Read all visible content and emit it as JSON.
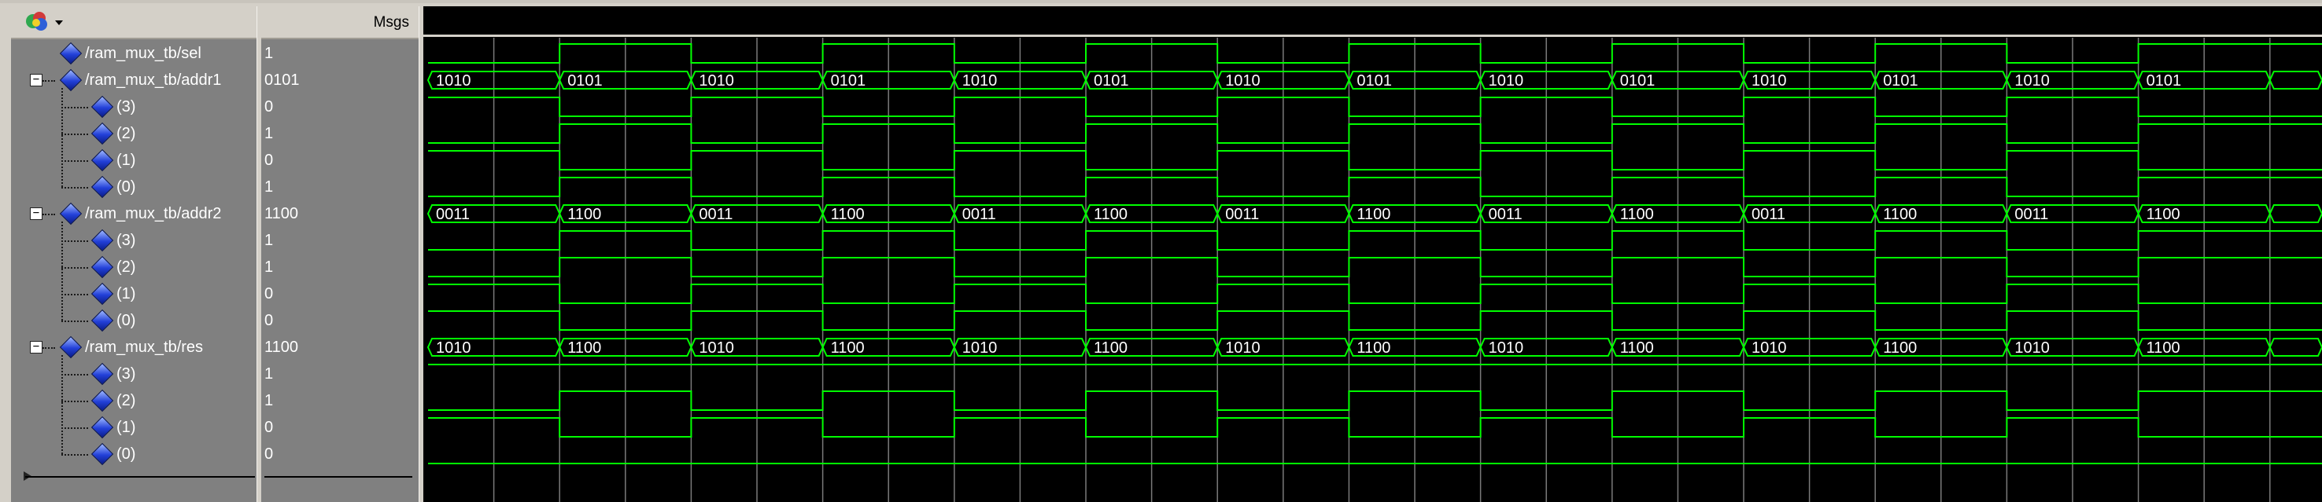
{
  "toolbar": {
    "wave_icon": "wave-palette-icon",
    "msgs_label": "Msgs"
  },
  "signals": [
    {
      "name": "/ram_mux_tb/sel",
      "value": "1",
      "kind": "bit",
      "level": 0
    },
    {
      "name": "/ram_mux_tb/addr1",
      "value": "0101",
      "kind": "bus",
      "level": 0,
      "expanded": true
    },
    {
      "name": "(3)",
      "value": "0",
      "kind": "bit",
      "level": 1
    },
    {
      "name": "(2)",
      "value": "1",
      "kind": "bit",
      "level": 1
    },
    {
      "name": "(1)",
      "value": "0",
      "kind": "bit",
      "level": 1
    },
    {
      "name": "(0)",
      "value": "1",
      "kind": "bit",
      "level": 1
    },
    {
      "name": "/ram_mux_tb/addr2",
      "value": "1100",
      "kind": "bus",
      "level": 0,
      "expanded": true
    },
    {
      "name": "(3)",
      "value": "1",
      "kind": "bit",
      "level": 1
    },
    {
      "name": "(2)",
      "value": "1",
      "kind": "bit",
      "level": 1
    },
    {
      "name": "(1)",
      "value": "0",
      "kind": "bit",
      "level": 1
    },
    {
      "name": "(0)",
      "value": "0",
      "kind": "bit",
      "level": 1
    },
    {
      "name": "/ram_mux_tb/res",
      "value": "1100",
      "kind": "bus",
      "level": 0,
      "expanded": true
    },
    {
      "name": "(3)",
      "value": "1",
      "kind": "bit",
      "level": 1
    },
    {
      "name": "(2)",
      "value": "1",
      "kind": "bit",
      "level": 1
    },
    {
      "name": "(1)",
      "value": "0",
      "kind": "bit",
      "level": 1
    },
    {
      "name": "(0)",
      "value": "0",
      "kind": "bit",
      "level": 1
    }
  ],
  "waveform": {
    "trace_color": "#00ff00",
    "grid_color": "#7a7a7a",
    "bus_text_color": "#ffffff",
    "segments": 14,
    "sel": [
      "0",
      "1",
      "0",
      "1",
      "0",
      "1",
      "0",
      "1",
      "0",
      "1",
      "0",
      "1",
      "0",
      "1"
    ],
    "addr1": [
      "1010",
      "0101",
      "1010",
      "0101",
      "1010",
      "0101",
      "1010",
      "0101",
      "1010",
      "0101",
      "1010",
      "0101",
      "1010",
      "0101"
    ],
    "addr2": [
      "0011",
      "1100",
      "0011",
      "1100",
      "0011",
      "1100",
      "0011",
      "1100",
      "0011",
      "1100",
      "0011",
      "1100",
      "0011",
      "1100"
    ],
    "res": [
      "1010",
      "1100",
      "1010",
      "1100",
      "1010",
      "1100",
      "1010",
      "1100",
      "1010",
      "1100",
      "1010",
      "1100",
      "1010",
      "1100"
    ]
  }
}
